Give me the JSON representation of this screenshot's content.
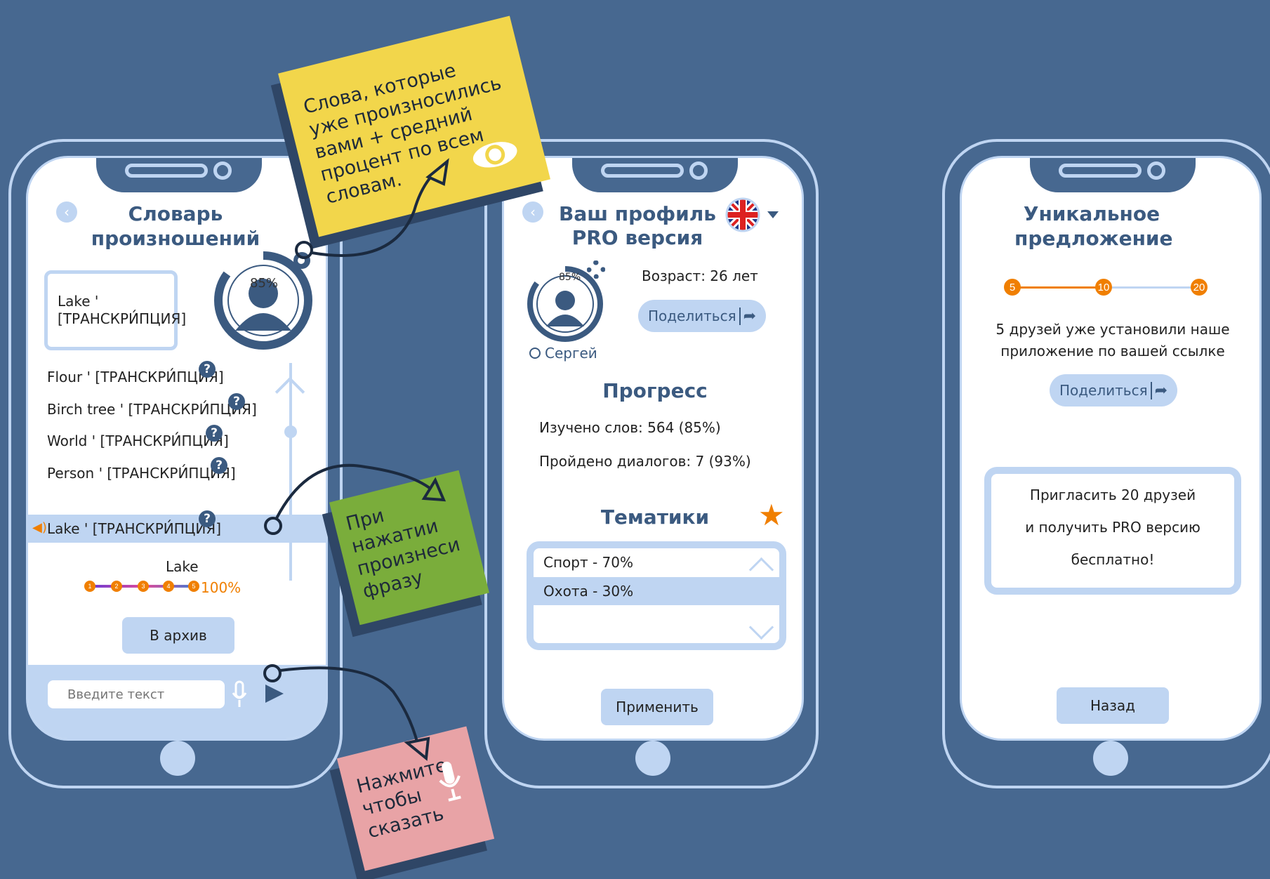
{
  "screen1": {
    "title": "Словарь произношений",
    "card": {
      "word": "Lake '",
      "transcription": "[ТРАНСКРИ́ПЦИЯ]"
    },
    "avatar_percent": "85%",
    "words": [
      {
        "text": "Flour ' [ТРАНСКРИ́ПЦИЯ]",
        "selected": false
      },
      {
        "text": "Birch tree ' [ТРАНСКРИ́ПЦИЯ]",
        "selected": false
      },
      {
        "text": "World ' [ТРАНСКРИ́ПЦИЯ]",
        "selected": false
      },
      {
        "text": "Person ' [ТРАНСКРИ́ПЦИЯ]",
        "selected": false
      },
      {
        "text": "Lake ' [ТРАНСКРИ́ПЦИЯ]",
        "selected": true
      }
    ],
    "help_glyph": "?",
    "progress_word": "Lake",
    "progress_steps": [
      "1",
      "2",
      "3",
      "4",
      "5"
    ],
    "progress_percent": "100%",
    "archive_button": "В архив",
    "input_placeholder": "Введите текст"
  },
  "screen2": {
    "title_line1": "Ваш профиль",
    "title_line2": "PRO версия",
    "avatar_percent": "85%",
    "age": "Возраст: 26 лет",
    "share_button": "Поделиться",
    "username": "Сергей",
    "progress_title": "Прогресс",
    "words_learned": "Изучено слов:  564 (85%)",
    "dialogs_done": "Пройдено диалогов: 7 (93%)",
    "topics_title": "Тематики",
    "topics": [
      {
        "label": "Спорт - 70%",
        "selected": false
      },
      {
        "label": "Охота - 30%",
        "selected": true
      }
    ],
    "apply_button": "Применить"
  },
  "screen3": {
    "title": "Уникальное предложение",
    "steps": [
      "5",
      "10",
      "20"
    ],
    "friends_text_line1": "5 друзей уже установили наше",
    "friends_text_line2": "приложение по вашей ссылке",
    "share_button": "Поделиться",
    "offer_line1": "Пригласить 20 друзей",
    "offer_line2": "и получить PRO версию",
    "offer_line3": "бесплатно!",
    "back_button": "Назад"
  },
  "notes": {
    "yellow": [
      "Слова, которые",
      "уже произносились",
      "вами + средний",
      "процент по всем",
      "словам."
    ],
    "green": [
      "При",
      "нажатии",
      "произнеси",
      "фразу"
    ],
    "pink": [
      "Нажмите,",
      "чтобы",
      "сказать"
    ]
  },
  "colors": {
    "background": "#476890",
    "phone_outline": "#bfd5f2",
    "title": "#3b5a80",
    "accent_orange": "#f07f00",
    "note_yellow": "#f2d64b",
    "note_green": "#7aad3b",
    "note_pink": "#e8a3a6"
  }
}
